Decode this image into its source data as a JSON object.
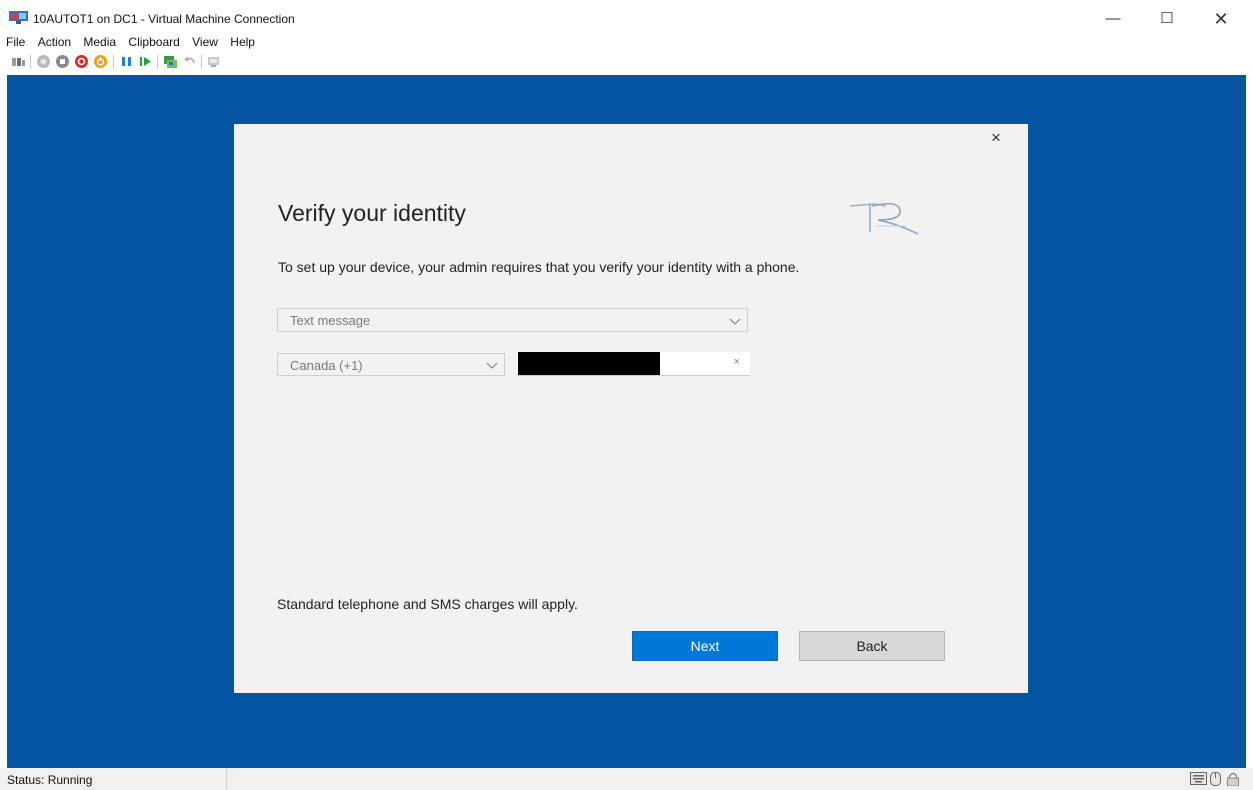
{
  "window": {
    "title": "10AUTOT1 on DC1 - Virtual Machine Connection",
    "minimize_glyph": "—",
    "maximize_glyph": "☐",
    "close_glyph": "✕"
  },
  "menu": [
    "File",
    "Action",
    "Media",
    "Clipboard",
    "View",
    "Help"
  ],
  "toolbar_icons": [
    "ctrl-alt-del-icon",
    "start-icon",
    "turn-off-icon",
    "shut-down-icon",
    "save-icon",
    "pause-icon",
    "reset-icon",
    "checkpoint-icon",
    "revert-icon",
    "enhanced-session-icon"
  ],
  "dialog": {
    "close_glyph": "×",
    "title": "Verify your identity",
    "description": "To set up your device, your admin requires that you verify your identity with a phone.",
    "method_select": {
      "value": "Text message"
    },
    "country_select": {
      "value": "Canada (+1)"
    },
    "phone_clear_glyph": "×",
    "sms_note": "Standard telephone and SMS charges will apply.",
    "next_label": "Next",
    "back_label": "Back"
  },
  "status": {
    "text": "Status: Running"
  },
  "colors": {
    "vm_background": "#0555a2",
    "dialog_background": "#f2f2f2",
    "primary_button": "#0078d7"
  }
}
